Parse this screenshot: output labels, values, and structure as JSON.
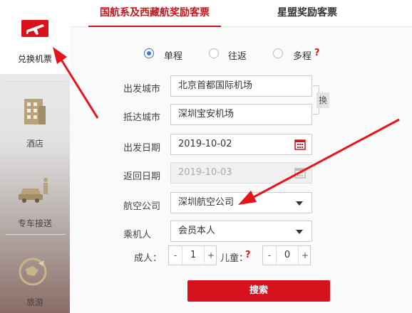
{
  "sidebar": {
    "items": [
      {
        "label": "兑换机票",
        "icon": "plane-ticket-icon"
      },
      {
        "label": "酒店",
        "icon": "hotel-building-icon"
      },
      {
        "label": "专车接送",
        "icon": "car-pickup-icon"
      },
      {
        "label": "旅游",
        "icon": "travel-globe-icon"
      }
    ]
  },
  "tabs": [
    {
      "label": "国航系及西藏航奖励客票",
      "active": true
    },
    {
      "label": "星盟奖励客票",
      "active": false
    }
  ],
  "trip_type": {
    "options": [
      "单程",
      "往返",
      "多程"
    ],
    "selected": "单程",
    "help": "?"
  },
  "form": {
    "departure_city": {
      "label": "出发城市",
      "value": "北京首都国际机场"
    },
    "arrival_city": {
      "label": "抵达城市",
      "value": "深圳宝安机场"
    },
    "swap_label": "换",
    "departure_date": {
      "label": "出发日期",
      "value": "2019-10-02"
    },
    "return_date": {
      "label": "返回日期",
      "value": "2019-10-03"
    },
    "airline": {
      "label": "航空公司",
      "value": "深圳航空公司"
    },
    "passenger": {
      "label": "乘机人",
      "value": "会员本人"
    },
    "adults": {
      "label": "成人：",
      "value": "1"
    },
    "children": {
      "label": "儿童：",
      "help": "?",
      "value": "0"
    },
    "minus": "-",
    "plus": "+"
  },
  "search_button": "搜索",
  "colors": {
    "brand_red": "#d8121c",
    "radio_blue": "#3a78d8",
    "arrow_red": "#e8141c"
  }
}
